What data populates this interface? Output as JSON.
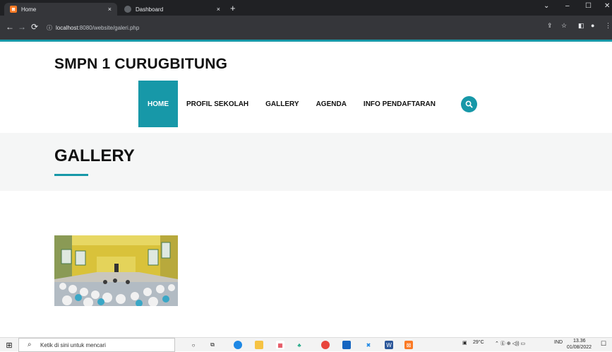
{
  "browser": {
    "tabs": [
      {
        "label": "Home",
        "favicon": "xampp-icon",
        "active": true
      },
      {
        "label": "Dashboard",
        "favicon": "globe-icon",
        "active": false
      }
    ],
    "tab_close": "×",
    "new_tab": "+",
    "window": {
      "minimize": "–",
      "maximize": "☐",
      "close": "✕",
      "menu": "⌄"
    },
    "url_host": "localhost",
    "url_rest": ":8080/website/galeri.php",
    "accent_color": "#1798a8"
  },
  "site": {
    "brand": "SMPN 1 CURUGBITUNG",
    "nav": [
      {
        "label": "HOME",
        "active": true
      },
      {
        "label": "PROFIL SEKOLAH",
        "active": false
      },
      {
        "label": "GALLERY",
        "active": false
      },
      {
        "label": "AGENDA",
        "active": false
      },
      {
        "label": "INFO PENDAFTARAN",
        "active": false
      }
    ],
    "search_icon": "search-icon"
  },
  "hero": {
    "title": "GALLERY"
  },
  "taskbar": {
    "search_placeholder": "Ketik di sini untuk mencari",
    "weather": "29°C",
    "language": "IND",
    "time": "13.36",
    "date": "01/08/2022"
  }
}
